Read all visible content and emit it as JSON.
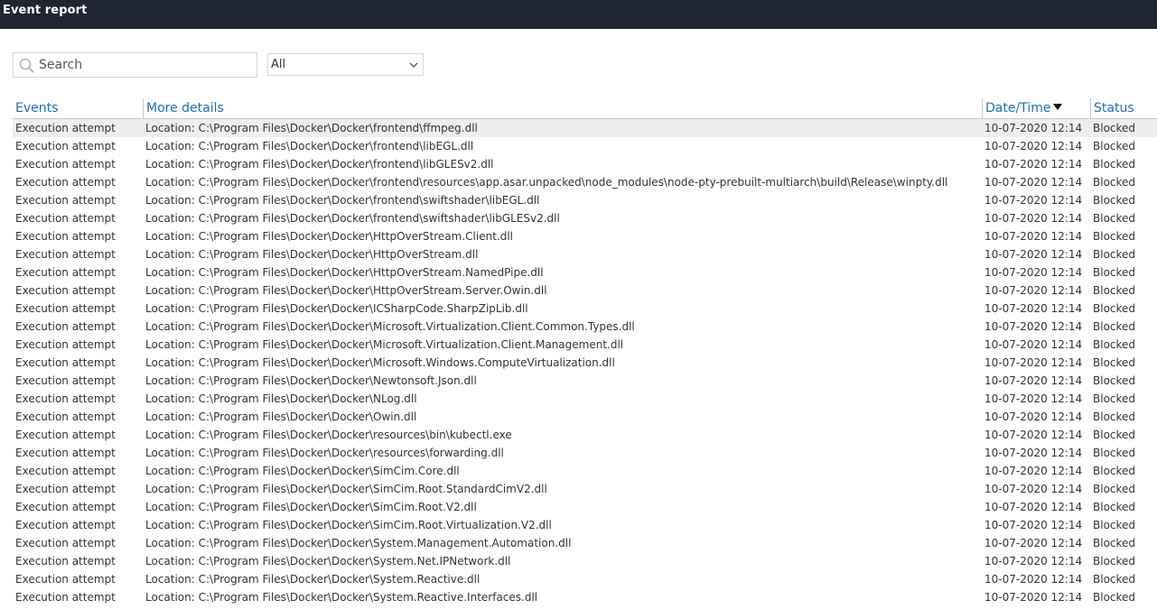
{
  "window": {
    "title": "Event report"
  },
  "search": {
    "placeholder": "Search"
  },
  "filter": {
    "selected": "All"
  },
  "table": {
    "columns": {
      "events": "Events",
      "details": "More details",
      "date": "Date/Time",
      "status": "Status"
    },
    "rows": [
      {
        "event": "Execution attempt",
        "details": "Location: C:\\Program Files\\Docker\\Docker\\frontend\\ffmpeg.dll",
        "date": "10-07-2020 12:14",
        "status": "Blocked"
      },
      {
        "event": "Execution attempt",
        "details": "Location: C:\\Program Files\\Docker\\Docker\\frontend\\libEGL.dll",
        "date": "10-07-2020 12:14",
        "status": "Blocked"
      },
      {
        "event": "Execution attempt",
        "details": "Location: C:\\Program Files\\Docker\\Docker\\frontend\\libGLESv2.dll",
        "date": "10-07-2020 12:14",
        "status": "Blocked"
      },
      {
        "event": "Execution attempt",
        "details": "Location: C:\\Program Files\\Docker\\Docker\\frontend\\resources\\app.asar.unpacked\\node_modules\\node-pty-prebuilt-multiarch\\build\\Release\\winpty.dll",
        "date": "10-07-2020 12:14",
        "status": "Blocked"
      },
      {
        "event": "Execution attempt",
        "details": "Location: C:\\Program Files\\Docker\\Docker\\frontend\\swiftshader\\libEGL.dll",
        "date": "10-07-2020 12:14",
        "status": "Blocked"
      },
      {
        "event": "Execution attempt",
        "details": "Location: C:\\Program Files\\Docker\\Docker\\frontend\\swiftshader\\libGLESv2.dll",
        "date": "10-07-2020 12:14",
        "status": "Blocked"
      },
      {
        "event": "Execution attempt",
        "details": "Location: C:\\Program Files\\Docker\\Docker\\HttpOverStream.Client.dll",
        "date": "10-07-2020 12:14",
        "status": "Blocked"
      },
      {
        "event": "Execution attempt",
        "details": "Location: C:\\Program Files\\Docker\\Docker\\HttpOverStream.dll",
        "date": "10-07-2020 12:14",
        "status": "Blocked"
      },
      {
        "event": "Execution attempt",
        "details": "Location: C:\\Program Files\\Docker\\Docker\\HttpOverStream.NamedPipe.dll",
        "date": "10-07-2020 12:14",
        "status": "Blocked"
      },
      {
        "event": "Execution attempt",
        "details": "Location: C:\\Program Files\\Docker\\Docker\\HttpOverStream.Server.Owin.dll",
        "date": "10-07-2020 12:14",
        "status": "Blocked"
      },
      {
        "event": "Execution attempt",
        "details": "Location: C:\\Program Files\\Docker\\Docker\\ICSharpCode.SharpZipLib.dll",
        "date": "10-07-2020 12:14",
        "status": "Blocked"
      },
      {
        "event": "Execution attempt",
        "details": "Location: C:\\Program Files\\Docker\\Docker\\Microsoft.Virtualization.Client.Common.Types.dll",
        "date": "10-07-2020 12:14",
        "status": "Blocked"
      },
      {
        "event": "Execution attempt",
        "details": "Location: C:\\Program Files\\Docker\\Docker\\Microsoft.Virtualization.Client.Management.dll",
        "date": "10-07-2020 12:14",
        "status": "Blocked"
      },
      {
        "event": "Execution attempt",
        "details": "Location: C:\\Program Files\\Docker\\Docker\\Microsoft.Windows.ComputeVirtualization.dll",
        "date": "10-07-2020 12:14",
        "status": "Blocked"
      },
      {
        "event": "Execution attempt",
        "details": "Location: C:\\Program Files\\Docker\\Docker\\Newtonsoft.Json.dll",
        "date": "10-07-2020 12:14",
        "status": "Blocked"
      },
      {
        "event": "Execution attempt",
        "details": "Location: C:\\Program Files\\Docker\\Docker\\NLog.dll",
        "date": "10-07-2020 12:14",
        "status": "Blocked"
      },
      {
        "event": "Execution attempt",
        "details": "Location: C:\\Program Files\\Docker\\Docker\\Owin.dll",
        "date": "10-07-2020 12:14",
        "status": "Blocked"
      },
      {
        "event": "Execution attempt",
        "details": "Location: C:\\Program Files\\Docker\\Docker\\resources\\bin\\kubectl.exe",
        "date": "10-07-2020 12:14",
        "status": "Blocked"
      },
      {
        "event": "Execution attempt",
        "details": "Location: C:\\Program Files\\Docker\\Docker\\resources\\forwarding.dll",
        "date": "10-07-2020 12:14",
        "status": "Blocked"
      },
      {
        "event": "Execution attempt",
        "details": "Location: C:\\Program Files\\Docker\\Docker\\SimCim.Core.dll",
        "date": "10-07-2020 12:14",
        "status": "Blocked"
      },
      {
        "event": "Execution attempt",
        "details": "Location: C:\\Program Files\\Docker\\Docker\\SimCim.Root.StandardCimV2.dll",
        "date": "10-07-2020 12:14",
        "status": "Blocked"
      },
      {
        "event": "Execution attempt",
        "details": "Location: C:\\Program Files\\Docker\\Docker\\SimCim.Root.V2.dll",
        "date": "10-07-2020 12:14",
        "status": "Blocked"
      },
      {
        "event": "Execution attempt",
        "details": "Location: C:\\Program Files\\Docker\\Docker\\SimCim.Root.Virtualization.V2.dll",
        "date": "10-07-2020 12:14",
        "status": "Blocked"
      },
      {
        "event": "Execution attempt",
        "details": "Location: C:\\Program Files\\Docker\\Docker\\System.Management.Automation.dll",
        "date": "10-07-2020 12:14",
        "status": "Blocked"
      },
      {
        "event": "Execution attempt",
        "details": "Location: C:\\Program Files\\Docker\\Docker\\System.Net.IPNetwork.dll",
        "date": "10-07-2020 12:14",
        "status": "Blocked"
      },
      {
        "event": "Execution attempt",
        "details": "Location: C:\\Program Files\\Docker\\Docker\\System.Reactive.dll",
        "date": "10-07-2020 12:14",
        "status": "Blocked"
      },
      {
        "event": "Execution attempt",
        "details": "Location: C:\\Program Files\\Docker\\Docker\\System.Reactive.Interfaces.dll",
        "date": "10-07-2020 12:14",
        "status": "Blocked"
      }
    ]
  },
  "colors": {
    "titlebar": "#1f2533",
    "header_link": "#1b6ec2",
    "selected_row": "#eeeeee"
  },
  "icons": {
    "search": "search-icon",
    "dropdown": "chevron-down-icon",
    "sort": "sort-descending-icon"
  }
}
